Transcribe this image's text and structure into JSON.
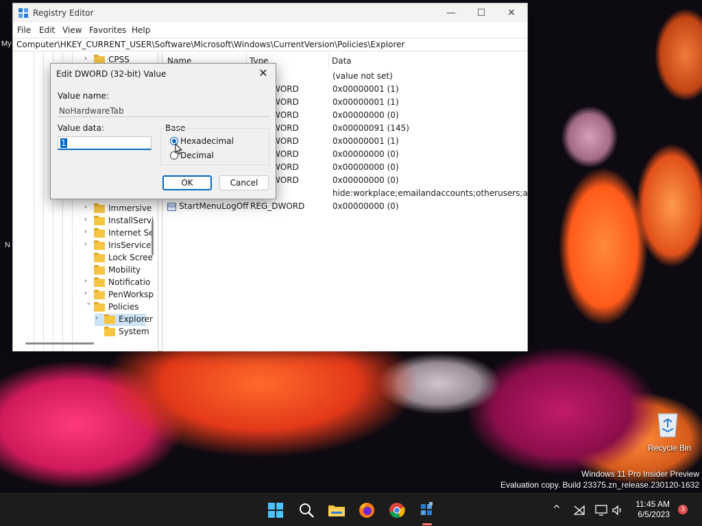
{
  "desktop": {
    "partial_labels": [
      "My",
      "N"
    ],
    "recycle_bin_label": "Recycle Bin",
    "watermark_line1": "Windows 11 Pro Insider Preview",
    "watermark_line2": "Evaluation copy. Build 23375.zn_release.230120-1632"
  },
  "window": {
    "title": "Registry Editor",
    "minimize_glyph": "—",
    "maximize_glyph": "☐",
    "close_glyph": "✕"
  },
  "menu": {
    "file": "File",
    "edit": "Edit",
    "view": "View",
    "favorites": "Favorites",
    "help": "Help"
  },
  "address": "Computer\\HKEY_CURRENT_USER\\Software\\Microsoft\\Windows\\CurrentVersion\\Policies\\Explorer",
  "tree": {
    "items": [
      {
        "label": "CPSS",
        "expandable": true
      },
      {
        "label": "Immersive",
        "expandable": true
      },
      {
        "label": "InstallServi",
        "expandable": true
      },
      {
        "label": "Internet Se",
        "expandable": true
      },
      {
        "label": "IrisService",
        "expandable": true
      },
      {
        "label": "Lock Scree",
        "expandable": false
      },
      {
        "label": "Mobility",
        "expandable": false
      },
      {
        "label": "Notificatio",
        "expandable": true
      },
      {
        "label": "PenWorksp",
        "expandable": true
      },
      {
        "label": "Policies",
        "expandable": true,
        "expanded": true
      },
      {
        "label": "Explorer",
        "expandable": true,
        "selected": true
      },
      {
        "label": "System",
        "expandable": false
      }
    ]
  },
  "list": {
    "headers": {
      "name": "Name",
      "type": "Type",
      "data": "Data"
    },
    "rows": [
      {
        "type": "",
        "data": "(value not set)"
      },
      {
        "type": "WORD",
        "data": "0x00000001 (1)"
      },
      {
        "type": "WORD",
        "data": "0x00000001 (1)"
      },
      {
        "type": "WORD",
        "data": "0x00000000 (0)"
      },
      {
        "type": "WORD",
        "data": "0x00000091 (145)"
      },
      {
        "type": "WORD",
        "data": "0x00000001 (1)"
      },
      {
        "type": "WORD",
        "data": "0x00000000 (0)"
      },
      {
        "type": "WORD",
        "data": "0x00000000 (0)"
      },
      {
        "type": "WORD",
        "data": "0x00000000 (0)"
      },
      {
        "type": "",
        "data": "hide:workplace;emailandaccounts;otherusers;assig..."
      },
      {
        "name": "StartMenuLogOff",
        "type": "REG_DWORD",
        "data": "0x00000000 (0)"
      }
    ],
    "dword_icon_text": "010"
  },
  "dialog": {
    "title": "Edit DWORD (32-bit) Value",
    "close_glyph": "✕",
    "value_name_label": "Value name:",
    "value_name": "NoHardwareTab",
    "value_data_label": "Value data:",
    "value_data": "1",
    "base_label": "Base",
    "hex_label": "Hexadecimal",
    "dec_label": "Decimal",
    "ok_label": "OK",
    "cancel_label": "Cancel"
  },
  "taskbar": {
    "time": "11:45 AM",
    "date": "6/5/2023",
    "notification_count": "3",
    "chevron_glyph": "^"
  },
  "colors": {
    "accent": "#0067c0",
    "taskbar": "#1c1c1c",
    "selection": "#cce4f7"
  }
}
